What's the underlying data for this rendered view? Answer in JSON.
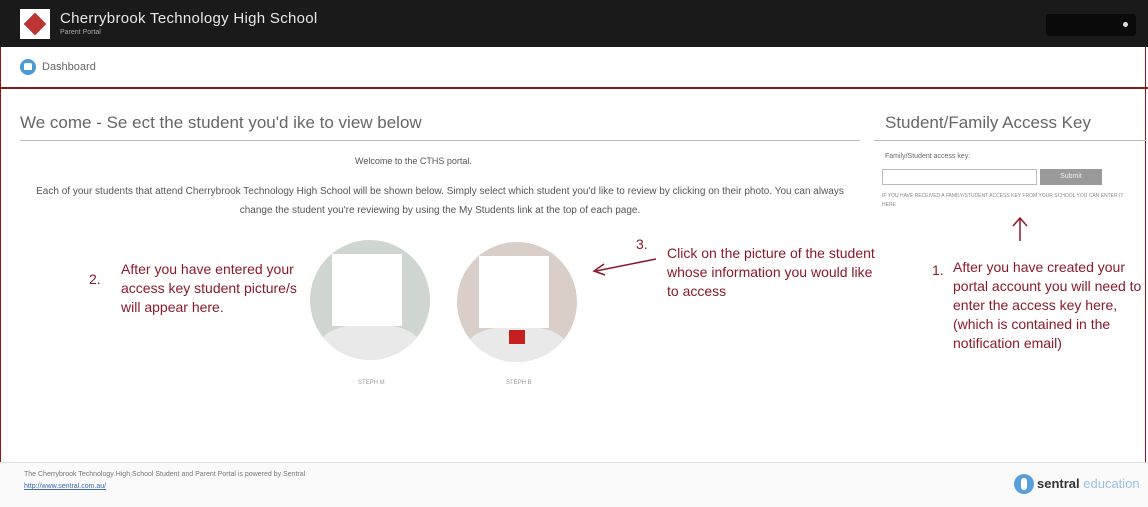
{
  "header": {
    "school_name": "Cherrybrook Technology High School",
    "subtitle": "Parent Portal"
  },
  "nav": {
    "dashboard_label": "Dashboard"
  },
  "main": {
    "heading": "We come - Se ect the student you'd  ike to view below",
    "intro": "Welcome to the CTHS portal.",
    "description": "Each of your students that attend Cherrybrook Technology High School will be shown below. Simply select which student you'd like to review by clicking on their photo. You can always change the student you're reviewing by using the My Students link at the top of each page.",
    "students": [
      {
        "name": "STEPH M"
      },
      {
        "name": "STEPH B"
      }
    ]
  },
  "annotations": {
    "a2_num": "2.",
    "a2_text": "After you have entered your access key student picture/s will appear here.",
    "a3_num": "3.",
    "a3_text": "Click on the picture of the student whose information you would like to access",
    "a1_num": "1.",
    "a1_text": "After you have created your portal account you will need to enter the access key here, (which is contained in the notification email)",
    "color": "#8b1a2a"
  },
  "sidebar": {
    "heading": "Student/Family Access Key",
    "key_label": "Family/Student access key:",
    "key_value": "",
    "submit_label": "Submit",
    "help_text": "IF YOU HAVE RECEIVED A FAMILY/STUDENT ACCESS KEY FROM YOUR SCHOOL YOU CAN ENTER IT HERE"
  },
  "footer": {
    "text": "The Cherrybrook Technology High School Student and Parent Portal is powered by Sentral",
    "link": "http://www.sentral.com.au/",
    "brand_main": "sentral",
    "brand_rest": " education"
  },
  "colors": {
    "topbar": "#1a1a1a",
    "accent": "#8a1a1a"
  }
}
